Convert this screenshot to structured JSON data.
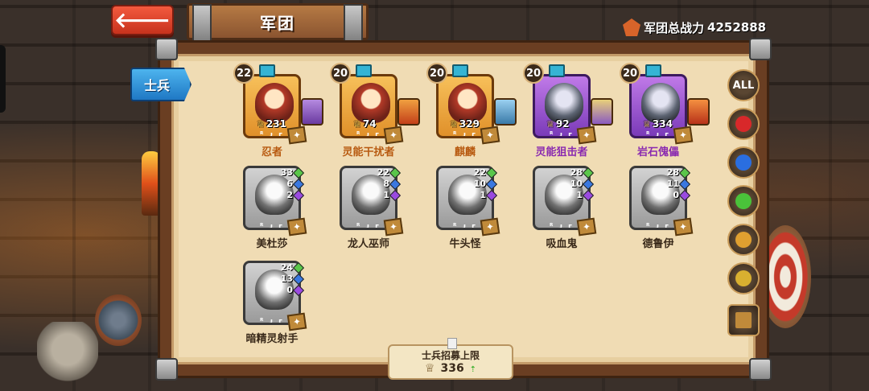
{
  "header": {
    "back_label": "🡐",
    "title": "军团",
    "power_label": "军团总战力",
    "power_value": "4252888"
  },
  "tabs": {
    "soldier": "士兵"
  },
  "units": [
    {
      "level": "22",
      "count": "231",
      "name": "忍者",
      "rarity": "orange",
      "equip": "e1"
    },
    {
      "level": "20",
      "count": "74",
      "name": "灵能干扰者",
      "rarity": "orange",
      "equip": "e2"
    },
    {
      "level": "20",
      "count": "329",
      "name": "麒麟",
      "rarity": "orange",
      "equip": "e3"
    },
    {
      "level": "20",
      "count": "92",
      "name": "灵能狙击者",
      "rarity": "purple",
      "equip": "e4"
    },
    {
      "level": "20",
      "count": "334",
      "name": "岩石傀儡",
      "rarity": "purple",
      "equip": "e5"
    }
  ],
  "locked_units": [
    {
      "name": "美杜莎",
      "s1": "33",
      "s2": "6",
      "s3": "2"
    },
    {
      "name": "龙人巫师",
      "s1": "22",
      "s2": "8",
      "s3": "1"
    },
    {
      "name": "牛头怪",
      "s1": "22",
      "s2": "10",
      "s3": "1"
    },
    {
      "name": "吸血鬼",
      "s1": "28",
      "s2": "10",
      "s3": "1"
    },
    {
      "name": "德鲁伊",
      "s1": "28",
      "s2": "11",
      "s3": "0"
    },
    {
      "name": "暗精灵射手",
      "s1": "24",
      "s2": "13",
      "s3": "0"
    }
  ],
  "rune_text": "ᴿ ᴊ ᴦ",
  "filters": [
    "ALL",
    "fire-icon",
    "water-icon",
    "nature-icon",
    "helmet-icon",
    "lion-icon",
    "flag-icon"
  ],
  "recruit": {
    "label": "士兵招募上限",
    "value": "336"
  },
  "colors": {
    "orange_name": "#b85a10",
    "purple_name": "#8a2ab0",
    "soldier_tab": "#2a8ad4",
    "back_button": "#e0442a"
  }
}
